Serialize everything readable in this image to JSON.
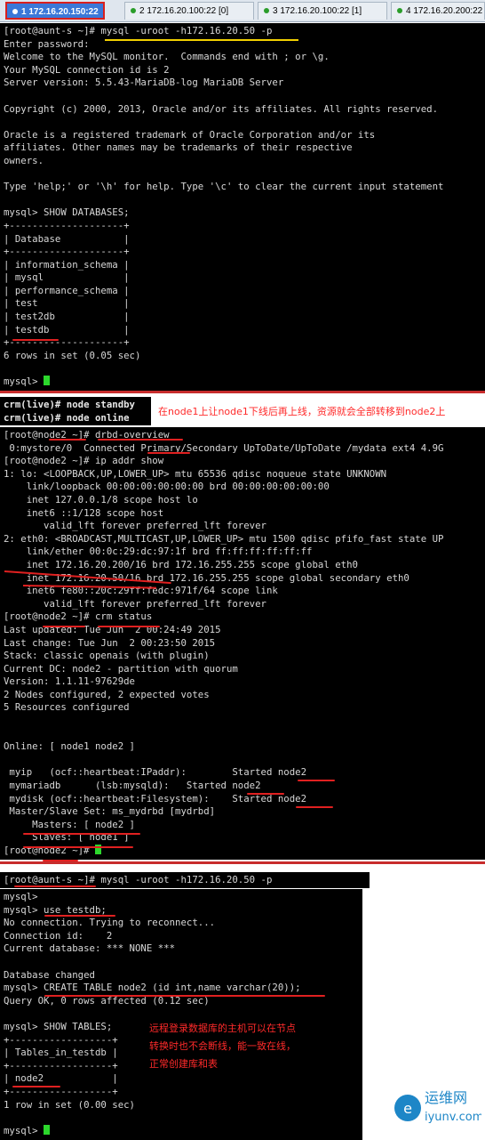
{
  "tabs": [
    {
      "number": "1",
      "label": "172.16.20.150:22",
      "active": true
    },
    {
      "number": "2",
      "label": "172.16.20.100:22 [0]",
      "active": false
    },
    {
      "number": "3",
      "label": "172.16.20.100:22 [1]",
      "active": false
    },
    {
      "number": "4",
      "label": "172.16.20.200:22",
      "active": false
    }
  ],
  "section1": {
    "lines": [
      "[root@aunt-s ~]# mysql -uroot -h172.16.20.50 -p",
      "Enter password:",
      "Welcome to the MySQL monitor.  Commands end with ; or \\g.",
      "Your MySQL connection id is 2",
      "Server version: 5.5.43-MariaDB-log MariaDB Server",
      "",
      "Copyright (c) 2000, 2013, Oracle and/or its affiliates. All rights reserved.",
      "",
      "Oracle is a registered trademark of Oracle Corporation and/or its",
      "affiliates. Other names may be trademarks of their respective",
      "owners.",
      "",
      "Type 'help;' or '\\h' for help. Type '\\c' to clear the current input statement",
      "",
      "mysql> SHOW DATABASES;",
      "+--------------------+",
      "| Database           |",
      "+--------------------+",
      "| information_schema |",
      "| mysql              |",
      "| performance_schema |",
      "| test               |",
      "| test2db            |",
      "| testdb             |",
      "+--------------------+",
      "6 rows in set (0.05 sec)",
      "",
      "mysql> "
    ]
  },
  "section2": {
    "lines": [
      "crm(live)# node standby",
      "crm(live)# node online"
    ],
    "note": "在node1上让node1下线后再上线，资源就会全部转移到node2上"
  },
  "section3": {
    "lines": [
      "[root@node2 ~]# drbd-overview",
      " 0:mystore/0  Connected Primary/Secondary UpToDate/UpToDate /mydata ext4 4.9G",
      "[root@node2 ~]# ip addr show",
      "1: lo: <LOOPBACK,UP,LOWER_UP> mtu 65536 qdisc noqueue state UNKNOWN",
      "    link/loopback 00:00:00:00:00:00 brd 00:00:00:00:00:00",
      "    inet 127.0.0.1/8 scope host lo",
      "    inet6 ::1/128 scope host",
      "       valid_lft forever preferred_lft forever",
      "2: eth0: <BROADCAST,MULTICAST,UP,LOWER_UP> mtu 1500 qdisc pfifo_fast state UP",
      "    link/ether 00:0c:29:dc:97:1f brd ff:ff:ff:ff:ff:ff",
      "    inet 172.16.20.200/16 brd 172.16.255.255 scope global eth0",
      "    inet 172.16.20.50/16 brd 172.16.255.255 scope global secondary eth0",
      "    inet6 fe80::20c:29ff:fedc:971f/64 scope link",
      "       valid_lft forever preferred_lft forever",
      "[root@node2 ~]# crm status",
      "Last updated: Tue Jun  2 00:24:49 2015",
      "Last change: Tue Jun  2 00:23:50 2015",
      "Stack: classic openais (with plugin)",
      "Current DC: node2 - partition with quorum",
      "Version: 1.1.11-97629de",
      "2 Nodes configured, 2 expected votes",
      "5 Resources configured",
      "",
      "",
      "Online: [ node1 node2 ]",
      "",
      " myip   (ocf::heartbeat:IPaddr):        Started node2",
      " mymariadb      (lsb:mysqld):   Started node2",
      " mydisk (ocf::heartbeat:Filesystem):    Started node2",
      " Master/Slave Set: ms_mydrbd [mydrbd]",
      "     Masters: [ node2 ]",
      "     Slaves: [ node1 ]",
      "[root@node2 ~]# "
    ]
  },
  "section4": {
    "prompt_line": "[root@aunt-s ~]# mysql -uroot -h172.16.20.50 -p",
    "lines": [
      "mysql>",
      "mysql> use testdb;",
      "No connection. Trying to reconnect...",
      "Connection id:    2",
      "Current database: *** NONE ***",
      "",
      "Database changed",
      "mysql> CREATE TABLE node2 (id int,name varchar(20));",
      "Query OK, 0 rows affected (0.12 sec)",
      "",
      "mysql> SHOW TABLES;",
      "+------------------+",
      "| Tables_in_testdb |",
      "+------------------+",
      "| node2            |",
      "+------------------+",
      "1 row in set (0.00 sec)",
      "",
      "mysql> "
    ],
    "notes": [
      "远程登录数据库的主机可以在节点",
      "转换时也不会断线，能一致在线，",
      "正常创建库和表"
    ]
  },
  "watermark": {
    "brand": "运维网",
    "domain": "iyunv.com"
  },
  "colors": {
    "terminal_bg": "#000000",
    "terminal_fg": "#d8d8d8",
    "highlight_green": "#2cd82c",
    "annotation_red": "#e02020",
    "active_tab": "#3b78d8"
  }
}
